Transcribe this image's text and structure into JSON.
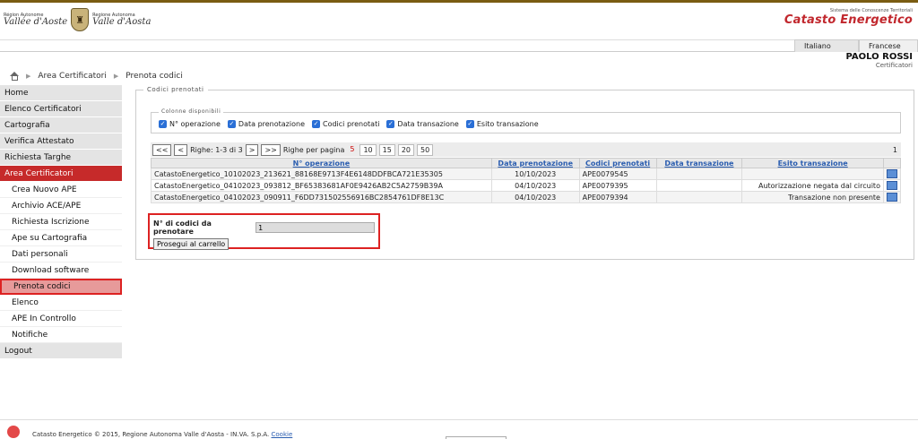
{
  "header": {
    "left_logo_small_1": "Région Autonome",
    "left_logo_big_1": "Vallée d'Aoste",
    "left_logo_small_2": "Regione Autonoma",
    "left_logo_big_2": "Valle d'Aosta",
    "right_subtitle": "Sistema delle Conoscenze Territoriali",
    "right_title": "Catasto Energetico",
    "right_mark": "SCT"
  },
  "languages": [
    "Italiano",
    "Francese"
  ],
  "user": {
    "name": "PAOLO ROSSI",
    "role": "Certificatori"
  },
  "breadcrumb": [
    "Area Certificatori",
    "Prenota codici"
  ],
  "sidebar": [
    {
      "label": "Home",
      "type": "top"
    },
    {
      "label": "Elenco Certificatori",
      "type": "top"
    },
    {
      "label": "Cartografia",
      "type": "top"
    },
    {
      "label": "Verifica Attestato",
      "type": "top"
    },
    {
      "label": "Richiesta Targhe",
      "type": "top"
    },
    {
      "label": "Area Certificatori",
      "type": "active"
    },
    {
      "label": "Crea Nuovo APE",
      "type": "sub"
    },
    {
      "label": "Archivio ACE/APE",
      "type": "sub"
    },
    {
      "label": "Richiesta Iscrizione",
      "type": "sub"
    },
    {
      "label": "Ape su Cartografia",
      "type": "sub"
    },
    {
      "label": "Dati personali",
      "type": "sub"
    },
    {
      "label": "Download software",
      "type": "sub"
    },
    {
      "label": "Prenota codici",
      "type": "current"
    },
    {
      "label": "Elenco",
      "type": "sub"
    },
    {
      "label": "APE In Controllo",
      "type": "sub"
    },
    {
      "label": "Notifiche",
      "type": "sub"
    },
    {
      "label": "Logout",
      "type": "top"
    }
  ],
  "panel": {
    "legend": "Codici prenotati",
    "columns_legend": "Colonne disponibili",
    "columns": [
      "N° operazione",
      "Data prenotazione",
      "Codici prenotati",
      "Data transazione",
      "Esito transazione"
    ],
    "pager": {
      "first": "<<",
      "prev": "<",
      "rows_text": "Righe: 1-3 di 3",
      "next": ">",
      "last": ">>",
      "per_page_label": "Righe per pagina",
      "sizes": [
        "5",
        "10",
        "15",
        "20",
        "50"
      ],
      "page": "1"
    },
    "table": {
      "headers": [
        "N° operazione",
        "Data prenotazione",
        "Codici prenotati",
        "Data transazione",
        "Esito transazione"
      ],
      "rows": [
        [
          "CatastoEnergetico_10102023_213621_88168E9713F4E6148DDFBCA721E35305",
          "10/10/2023",
          "APE0079545",
          "",
          ""
        ],
        [
          "CatastoEnergetico_04102023_093812_BF65383681AF0E9426AB2C5A2759B39A",
          "04/10/2023",
          "APE0079395",
          "",
          "Autorizzazione negata dal circuito"
        ],
        [
          "CatastoEnergetico_04102023_090911_F6DD731502556916BC2854761DF8E13C",
          "04/10/2023",
          "APE0079394",
          "",
          "Transazione non presente"
        ]
      ]
    },
    "request": {
      "label": "N° di codici da prenotare",
      "value": "1",
      "button": "Prosegui al carrello"
    }
  },
  "footer": {
    "text": "Catasto Energetico © 2015, Regione Autonoma Valle d'Aosta - IN.VA. S.p.A.",
    "link": "Cookie"
  }
}
